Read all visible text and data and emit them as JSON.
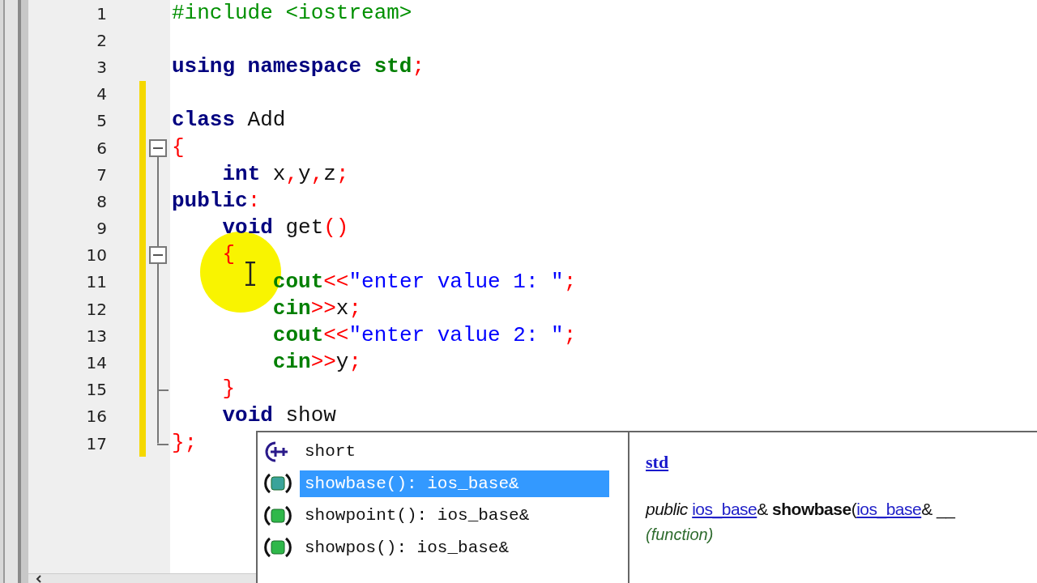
{
  "editor": {
    "lines": [
      {
        "number": "1",
        "modified": false,
        "kind": "plain",
        "tokens": [
          {
            "kind": "preproc",
            "text": "#include <iostream>"
          }
        ]
      },
      {
        "number": "2",
        "modified": false,
        "kind": "plain"
      },
      {
        "number": "3",
        "modified": false,
        "kind": "plain",
        "tokens": [
          {
            "kind": "keyword",
            "text": "using namespace"
          },
          {
            "kind": "stdname",
            "text": " std"
          },
          {
            "kind": "op",
            "text": ";"
          }
        ]
      },
      {
        "number": "4",
        "modified": true,
        "kind": "plain"
      },
      {
        "number": "5",
        "modified": true,
        "kind": "plain",
        "tokens": [
          {
            "kind": "keyword",
            "text": "class"
          },
          {
            "kind": "ident",
            "text": " Add"
          }
        ]
      },
      {
        "number": "6",
        "modified": true,
        "kind": "fold-start",
        "tokens": [
          {
            "kind": "op",
            "text": "{"
          }
        ]
      },
      {
        "number": "7",
        "modified": true,
        "kind": "fold-body",
        "tokens": [
          {
            "kind": "keyword",
            "text": "    int"
          },
          {
            "kind": "ident",
            "text": " x"
          },
          {
            "kind": "op",
            "text": ","
          },
          {
            "kind": "ident",
            "text": "y"
          },
          {
            "kind": "op",
            "text": ","
          },
          {
            "kind": "ident",
            "text": "z"
          },
          {
            "kind": "op",
            "text": ";"
          }
        ]
      },
      {
        "number": "8",
        "modified": true,
        "kind": "fold-body",
        "tokens": [
          {
            "kind": "keyword",
            "text": "public"
          },
          {
            "kind": "op",
            "text": ":"
          }
        ]
      },
      {
        "number": "9",
        "modified": true,
        "kind": "fold-body",
        "tokens": [
          {
            "kind": "keyword",
            "text": "    void"
          },
          {
            "kind": "ident",
            "text": " get"
          },
          {
            "kind": "op",
            "text": "()"
          }
        ]
      },
      {
        "number": "10",
        "modified": true,
        "kind": "fold-inner-start",
        "tokens": [
          {
            "kind": "op",
            "text": "    {"
          }
        ]
      },
      {
        "number": "11",
        "modified": true,
        "kind": "fold-body",
        "tokens": [
          {
            "kind": "stdname",
            "text": "        cout"
          },
          {
            "kind": "op",
            "text": "<<"
          },
          {
            "kind": "string",
            "text": "\"enter value 1: \""
          },
          {
            "kind": "op",
            "text": ";"
          }
        ]
      },
      {
        "number": "12",
        "modified": true,
        "kind": "fold-body",
        "tokens": [
          {
            "kind": "stdname",
            "text": "        cin"
          },
          {
            "kind": "op",
            "text": ">>"
          },
          {
            "kind": "ident",
            "text": "x"
          },
          {
            "kind": "op",
            "text": ";"
          }
        ]
      },
      {
        "number": "13",
        "modified": true,
        "kind": "fold-body",
        "tokens": [
          {
            "kind": "stdname",
            "text": "        cout"
          },
          {
            "kind": "op",
            "text": "<<"
          },
          {
            "kind": "string",
            "text": "\"enter value 2: \""
          },
          {
            "kind": "op",
            "text": ";"
          }
        ]
      },
      {
        "number": "14",
        "modified": true,
        "kind": "fold-body",
        "tokens": [
          {
            "kind": "stdname",
            "text": "        cin"
          },
          {
            "kind": "op",
            "text": ">>"
          },
          {
            "kind": "ident",
            "text": "y"
          },
          {
            "kind": "op",
            "text": ";"
          }
        ]
      },
      {
        "number": "15",
        "modified": true,
        "kind": "fold-inner-end",
        "tokens": [
          {
            "kind": "op",
            "text": "    }"
          }
        ]
      },
      {
        "number": "16",
        "modified": true,
        "kind": "fold-body",
        "tokens": [
          {
            "kind": "keyword",
            "text": "    void"
          },
          {
            "kind": "ident",
            "text": " show"
          }
        ]
      },
      {
        "number": "17",
        "modified": true,
        "kind": "fold-end",
        "tokens": [
          {
            "kind": "op",
            "text": "};"
          }
        ]
      }
    ]
  },
  "autocomplete": {
    "items": [
      {
        "kind": "keyword",
        "label": "short",
        "selected": false
      },
      {
        "kind": "function",
        "label": "showbase(): ios_base&",
        "selected": true
      },
      {
        "kind": "function",
        "label": "showpoint(): ios_base&",
        "selected": false
      },
      {
        "kind": "function",
        "label": "showpos(): ios_base&",
        "selected": false
      }
    ],
    "doc": {
      "scope": "std",
      "signature": [
        {
          "kind": "italic",
          "text": "public "
        },
        {
          "kind": "link",
          "text": "ios_base"
        },
        {
          "kind": "plain",
          "text": "& "
        },
        {
          "kind": "bold",
          "text": "showbase"
        },
        {
          "kind": "plain",
          "text": "("
        },
        {
          "kind": "link",
          "text": "ios_base"
        },
        {
          "kind": "plain",
          "text": "& __"
        }
      ],
      "note": "(function)"
    }
  }
}
